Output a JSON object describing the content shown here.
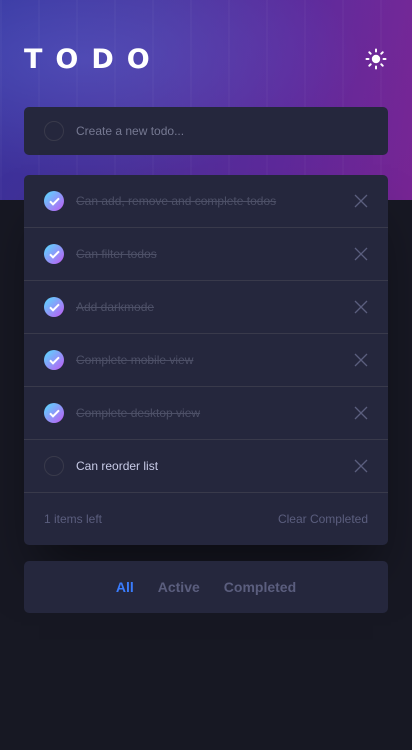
{
  "header": {
    "title": "TODO"
  },
  "new_todo": {
    "placeholder": "Create a new todo..."
  },
  "todos": [
    {
      "text": "Can add, remove and complete todos",
      "completed": true
    },
    {
      "text": "Can filter todos",
      "completed": true
    },
    {
      "text": "Add darkmode",
      "completed": true
    },
    {
      "text": "Complete mobile view",
      "completed": true
    },
    {
      "text": "Complete desktop view",
      "completed": true
    },
    {
      "text": "Can reorder list",
      "completed": false
    }
  ],
  "footer": {
    "items_left": "1 items left",
    "clear_label": "Clear Completed"
  },
  "filters": {
    "all": "All",
    "active": "Active",
    "completed": "Completed",
    "selected": "All"
  },
  "colors": {
    "accent": "#3a7cfd",
    "check_gradient_start": "#55ddff",
    "check_gradient_end": "#c058f3",
    "card": "#25273d",
    "background": "#171823"
  },
  "icons": {
    "theme_toggle": "sun-icon",
    "checkmark": "check-icon",
    "remove": "close-icon"
  }
}
